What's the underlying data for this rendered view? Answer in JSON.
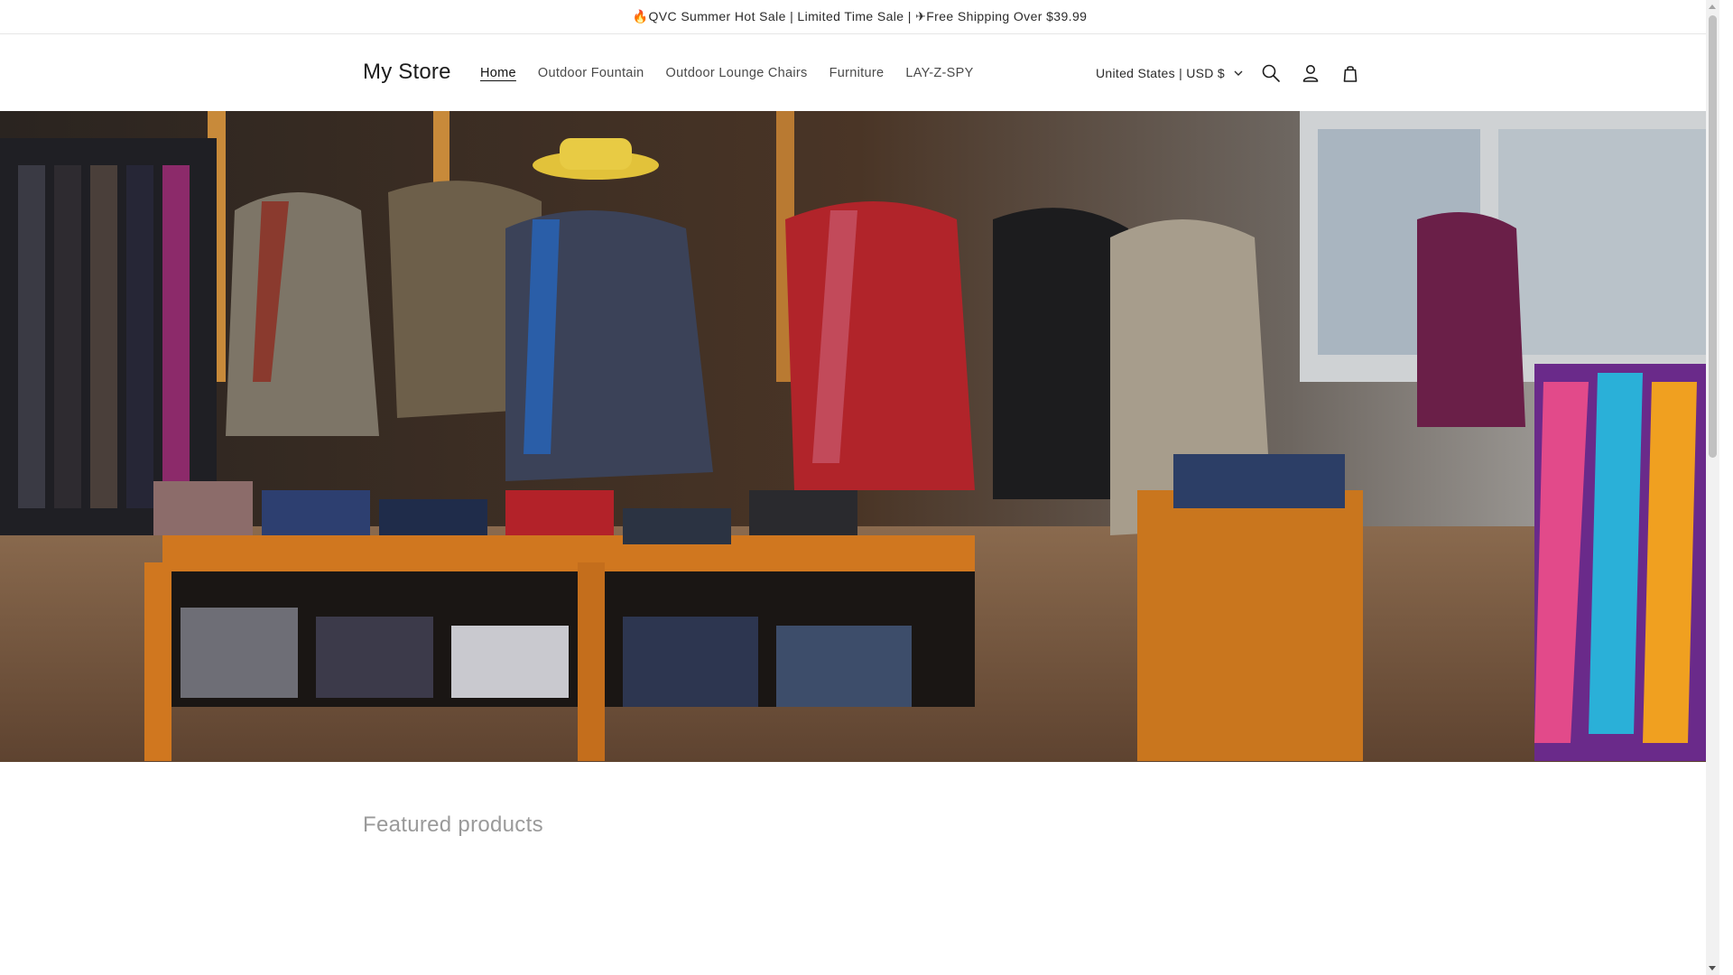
{
  "announcement": {
    "text": "🔥QVC Summer Hot Sale | Limited Time Sale | ✈Free Shipping Over $39.99"
  },
  "header": {
    "logo": "My Store",
    "nav": [
      {
        "label": "Home",
        "active": true
      },
      {
        "label": "Outdoor Fountain",
        "active": false
      },
      {
        "label": "Outdoor Lounge Chairs",
        "active": false
      },
      {
        "label": "Furniture",
        "active": false
      },
      {
        "label": "LAY-Z-SPY",
        "active": false
      }
    ],
    "country_selector": "United States | USD $",
    "icons": [
      "search-icon",
      "account-icon",
      "cart-icon"
    ]
  },
  "hero": {
    "image": "menswear-store-interior-photo"
  },
  "featured": {
    "title": "Featured products"
  },
  "colors": {
    "text": "#121212",
    "muted": "#9a9a9a",
    "accent_border": "#e6e6e6"
  }
}
